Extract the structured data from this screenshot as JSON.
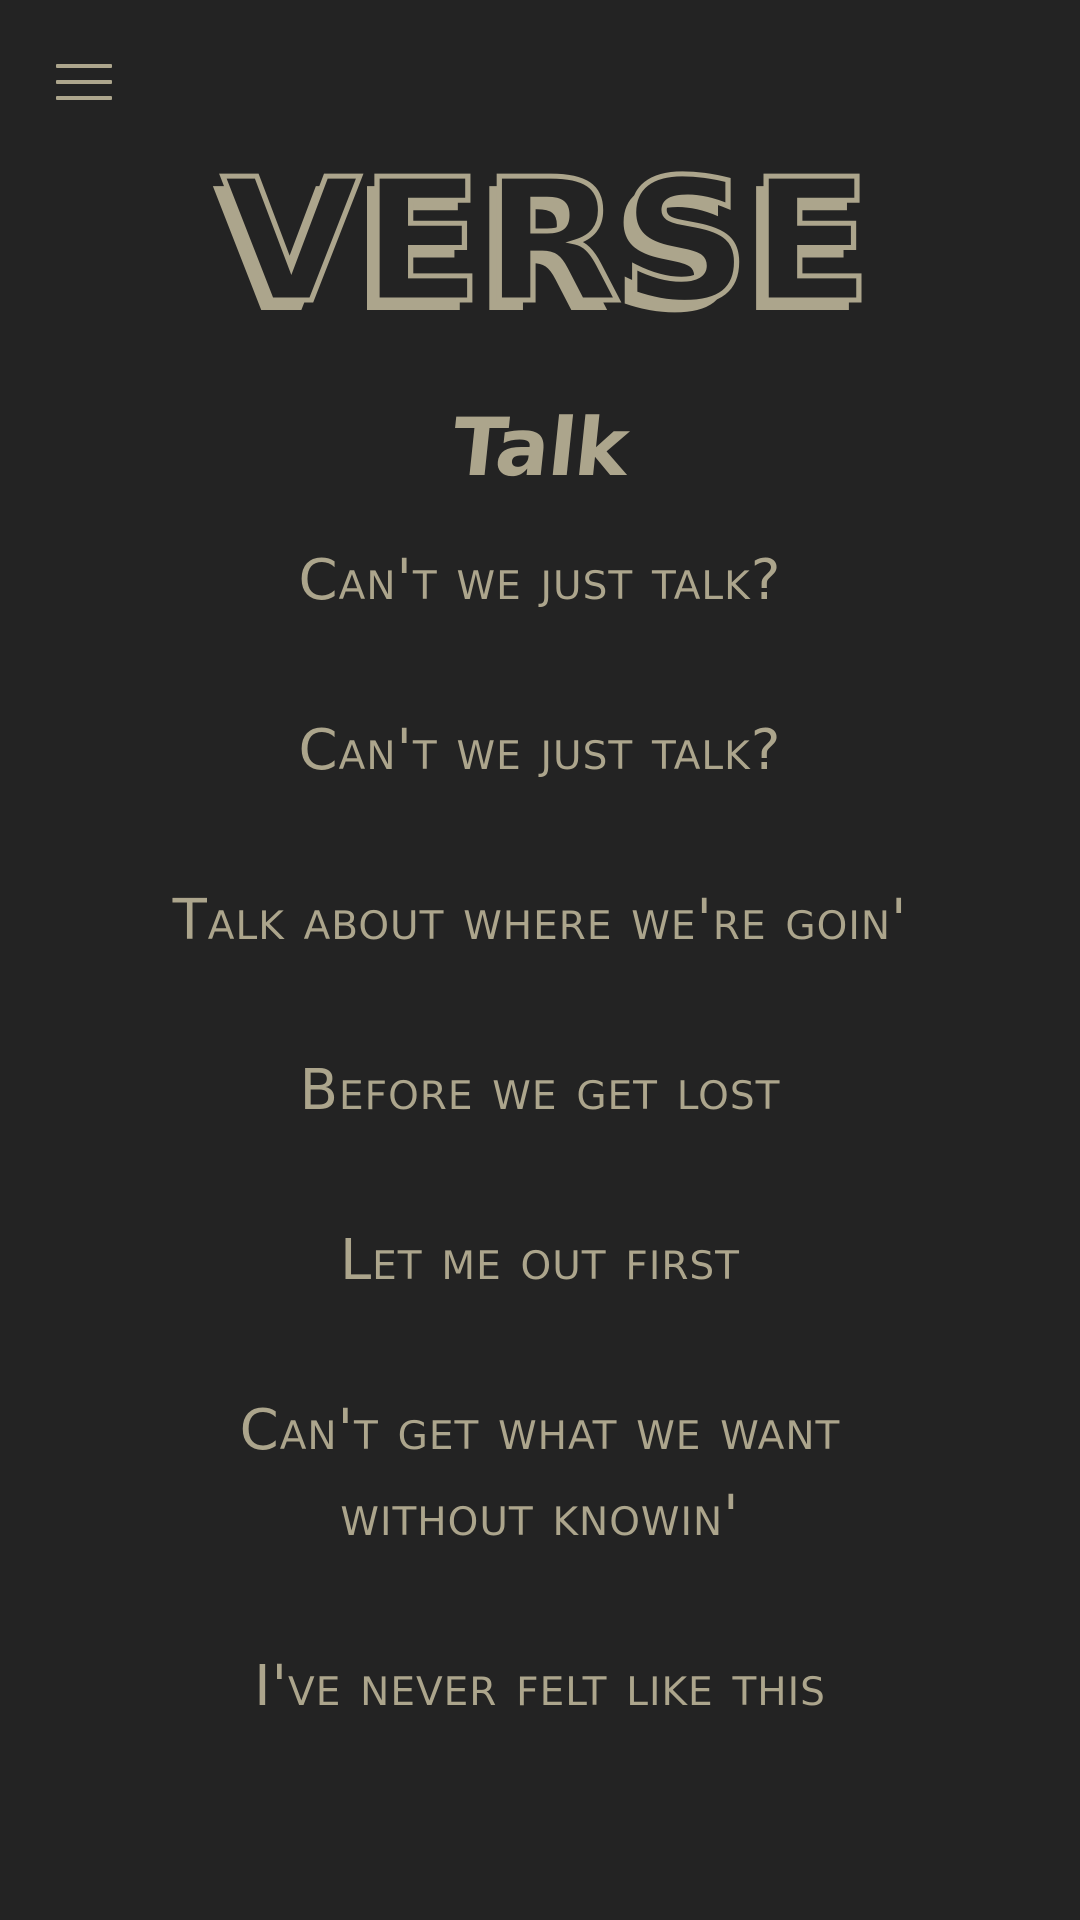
{
  "header": {
    "menu_icon": "hamburger-menu-icon",
    "logo_text": "VERSE"
  },
  "song": {
    "title": "Talk",
    "lines": [
      "Can't we just talk?",
      "Can't we just talk?",
      "Talk about where we're goin'",
      "Before we get lost",
      "Let me out first",
      "Can't get what we want without knowin'",
      "I've never felt like this"
    ]
  },
  "colors": {
    "background": "#232323",
    "accent": "#aca58c"
  }
}
